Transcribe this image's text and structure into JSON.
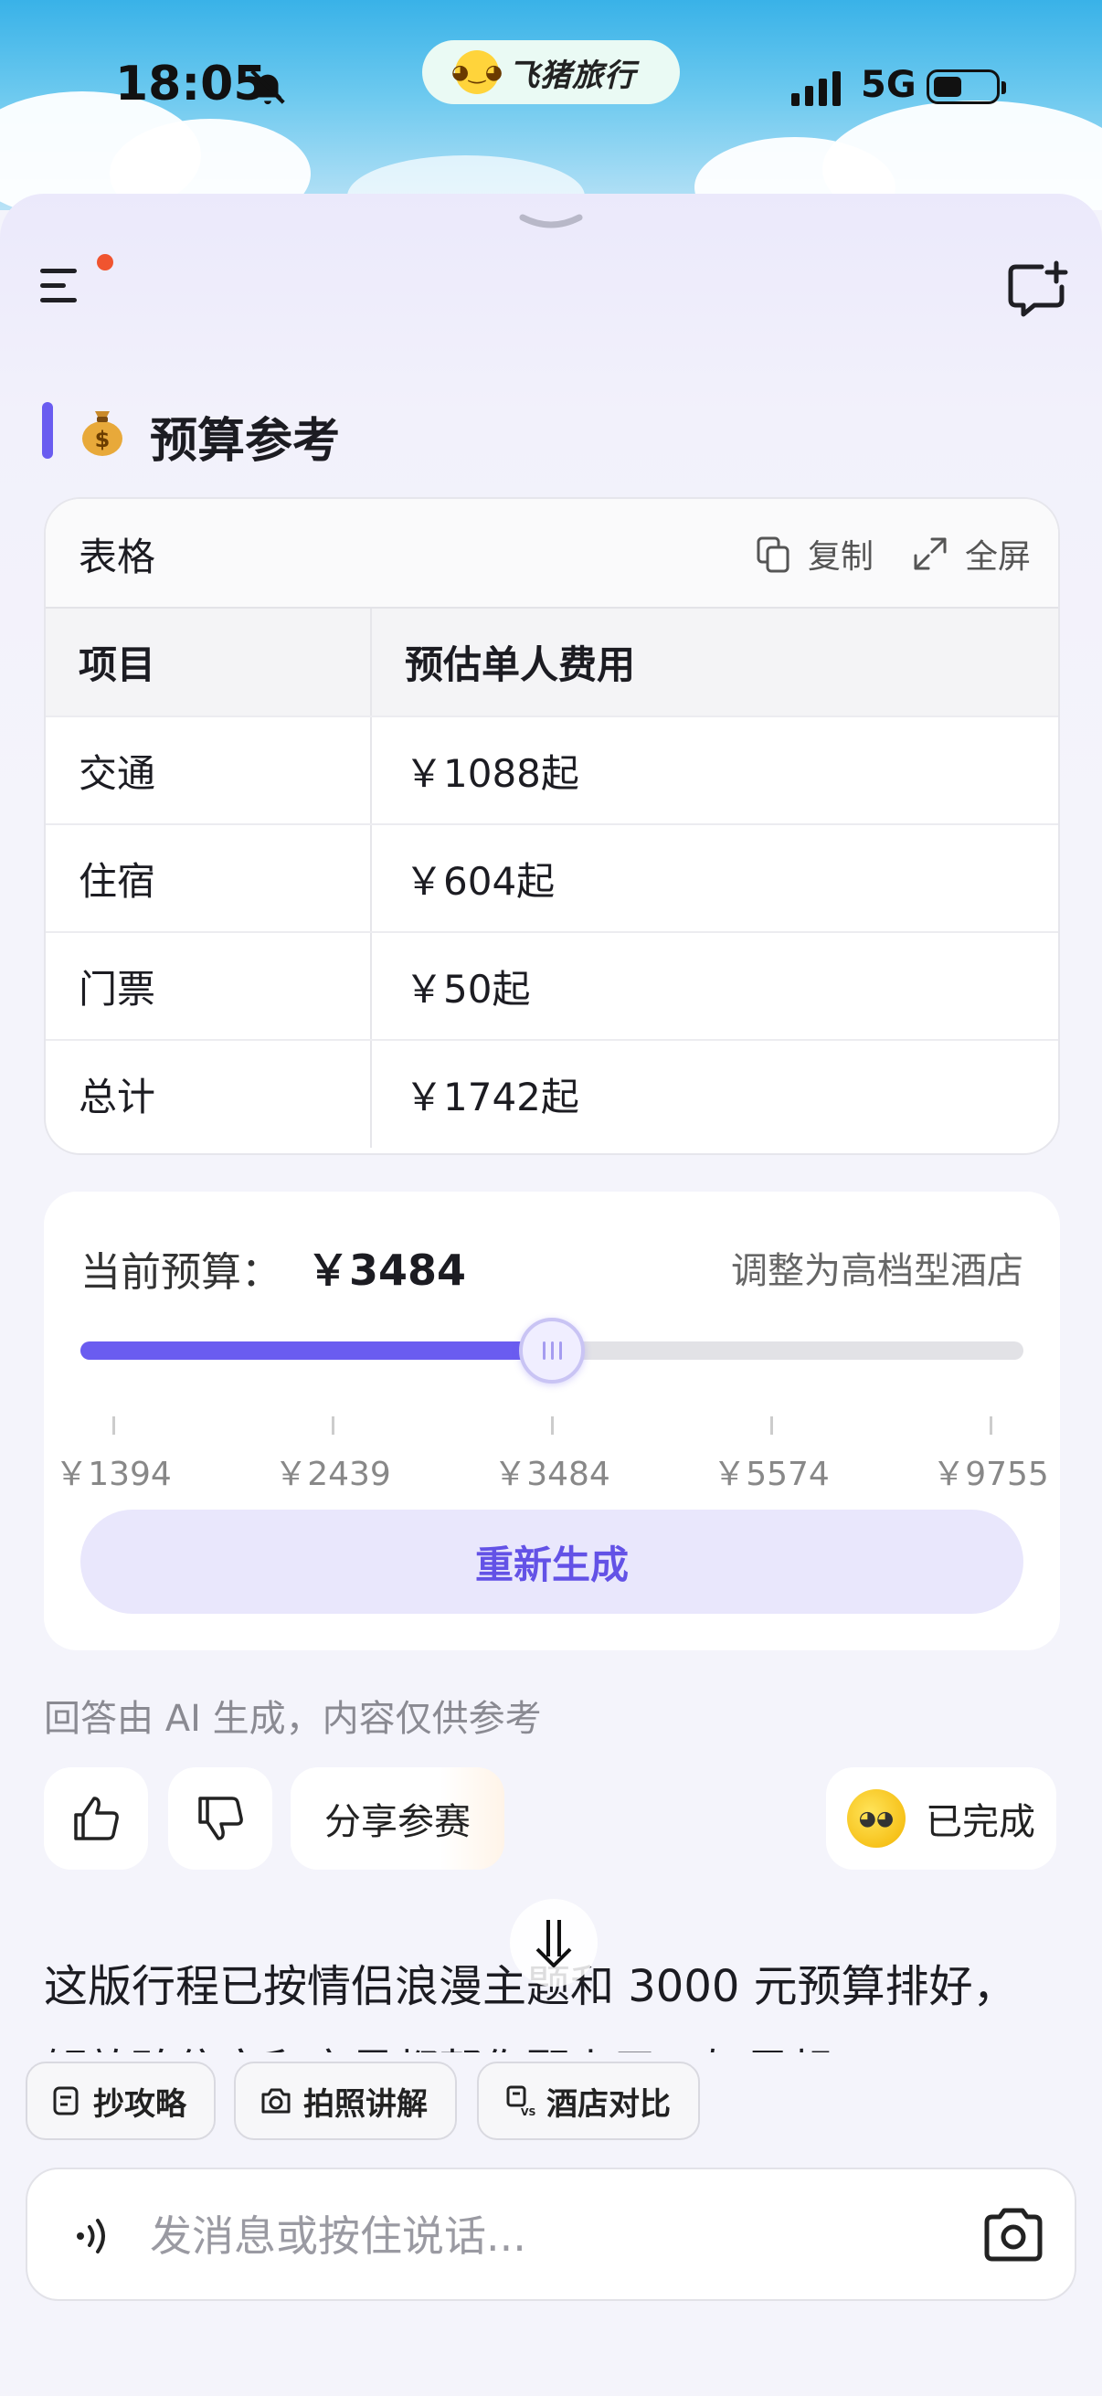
{
  "status_bar": {
    "time": "18:05",
    "app_pill": "飞猪旅行",
    "network": "5G"
  },
  "section": {
    "emoji": "money-bag",
    "title": "预算参考"
  },
  "table": {
    "title": "表格",
    "copy_label": "复制",
    "fullscreen_label": "全屏",
    "headers": [
      "项目",
      "预估单人费用"
    ],
    "rows": [
      [
        "交通",
        "￥1088起"
      ],
      [
        "住宿",
        "￥604起"
      ],
      [
        "门票",
        "￥50起"
      ],
      [
        "总计",
        "￥1742起"
      ]
    ]
  },
  "budget": {
    "label": "当前预算：",
    "value": "￥3484",
    "adjust_label": "调整为高档型酒店",
    "slider_fraction": 0.5,
    "ticks": [
      "￥1394",
      "￥2439",
      "￥3484",
      "￥5574",
      "￥9755"
    ],
    "regenerate_label": "重新生成"
  },
  "disclaimer": "回答由 AI 生成，内容仅供参考",
  "actions": {
    "share_label": "分享参赛",
    "done_label": "已完成"
  },
  "message": {
    "text": "这版行程已按情侣浪漫主题和 3000 元预算排好，解放碑住宿和夜景都帮你配上了，如果想"
  },
  "quick_actions": [
    "抄攻略",
    "拍照讲解",
    "酒店对比"
  ],
  "input": {
    "placeholder": "发消息或按住说话..."
  },
  "colors": {
    "accent": "#6a5cf0",
    "accent_light": "#e9e7fc",
    "badge_red": "#f0542f"
  }
}
